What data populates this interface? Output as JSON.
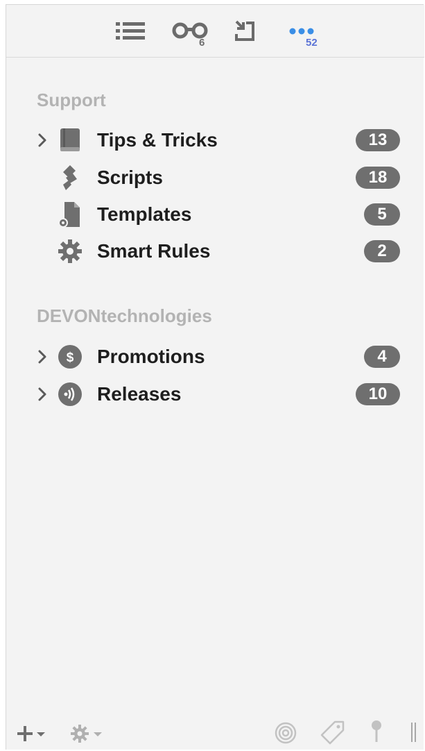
{
  "toolbar": {
    "items": [
      {
        "icon": "list-icon",
        "badge": ""
      },
      {
        "icon": "reading-glasses-icon",
        "badge": "6"
      },
      {
        "icon": "inbox-import-icon",
        "badge": ""
      },
      {
        "icon": "more-dots-icon",
        "badge": "52"
      }
    ]
  },
  "sections": [
    {
      "header": "Support",
      "items": [
        {
          "label": "Tips & Tricks",
          "count": "13",
          "icon": "book-icon",
          "expandable": true
        },
        {
          "label": "Scripts",
          "count": "18",
          "icon": "script-icon",
          "expandable": false
        },
        {
          "label": "Templates",
          "count": "5",
          "icon": "template-icon",
          "expandable": false
        },
        {
          "label": "Smart Rules",
          "count": "2",
          "icon": "gear-icon",
          "expandable": false
        }
      ]
    },
    {
      "header": "DEVONtechnologies",
      "items": [
        {
          "label": "Promotions",
          "count": "4",
          "icon": "dollar-icon",
          "expandable": true
        },
        {
          "label": "Releases",
          "count": "10",
          "icon": "broadcast-icon",
          "expandable": true
        }
      ]
    }
  ],
  "bottom_bar": {
    "items": [
      "add-icon",
      "action-gear-icon",
      "concordance-icon",
      "tag-icon",
      "pin-icon",
      "split-handle-icon"
    ]
  },
  "colors": {
    "badge_bg": "#6f6f6f",
    "accent_blue": "#3a8ee6",
    "section_header": "#b3b3b3"
  }
}
